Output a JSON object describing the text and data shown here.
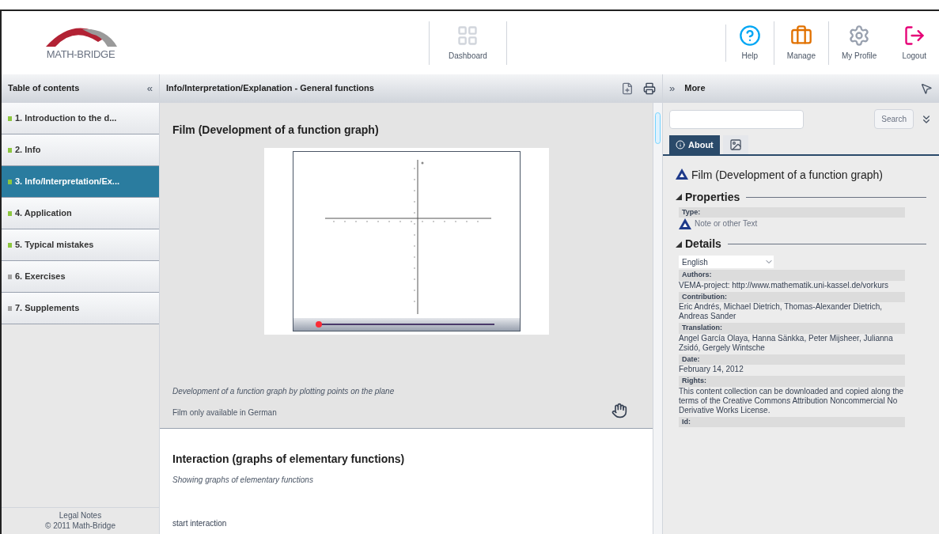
{
  "header": {
    "logo": "MATH-BRIDGE",
    "nav": [
      {
        "kind": "dashboard",
        "label": "Dashboard"
      },
      {
        "kind": "help",
        "label": "Help"
      },
      {
        "kind": "manage",
        "label": "Manage"
      },
      {
        "kind": "profile",
        "label": "My Profile"
      },
      {
        "kind": "logout",
        "label": "Logout"
      }
    ]
  },
  "sidebar": {
    "title": "Table of contents",
    "collapse": "«",
    "items": [
      {
        "label": "1. Introduction to the d...",
        "selected": false,
        "color": "#8cc63f"
      },
      {
        "label": "2. Info",
        "selected": false,
        "color": "#8cc63f"
      },
      {
        "label": "3. Info/Interpretation/Ex...",
        "selected": true,
        "color": "#8cc63f"
      },
      {
        "label": "4. Application",
        "selected": false,
        "color": "#8cc63f"
      },
      {
        "label": "5. Typical mistakes",
        "selected": false,
        "color": "#8cc63f"
      },
      {
        "label": "6. Exercises",
        "selected": false,
        "color": "#a0a0a0"
      },
      {
        "label": "7. Supplements",
        "selected": false,
        "color": "#a0a0a0"
      }
    ],
    "footer": [
      "Legal Notes",
      "© 2011 Math-Bridge"
    ]
  },
  "main": {
    "title": "Info/Interpretation/Explanation - General functions",
    "sections": [
      {
        "title": "Film (Development of a function graph)",
        "kind": "film",
        "caption": "Development of a function graph by plotting points on the plane",
        "note": "Film only available in German"
      },
      {
        "title": "Interaction (graphs of elementary functions)",
        "kind": "interaction",
        "caption": "Showing graphs of elementary functions",
        "note": "start interaction"
      }
    ]
  },
  "more": {
    "title": "More",
    "expand": "»",
    "search_button": "Search",
    "tabs": [
      {
        "kind": "about",
        "label": "About",
        "selected": true
      },
      {
        "kind": "icon",
        "selected": false
      }
    ],
    "item_title": "Film (Development of a function graph)",
    "properties": {
      "title": "Properties",
      "expanded": true,
      "fields": [
        {
          "label": "Type:",
          "value": "Note or other Text"
        }
      ]
    },
    "details": {
      "title": "Details",
      "expanded": true,
      "language": "English",
      "fields": [
        {
          "label": "Authors:",
          "value": "VEMA-project: http://www.mathematik.uni-kassel.de/vorkurs"
        },
        {
          "label": "Contribution:",
          "value": "Eric Andrés, Michael Dietrich, Thomas-Alexander Dietrich, Andreas Sander"
        },
        {
          "label": "Translation:",
          "value": "Angel García Olaya, Hanna Sänkka, Peter Mijsheer, Julianna Zsidó, Gergely Wintsche"
        },
        {
          "label": "Date:",
          "value": "February 14, 2012"
        },
        {
          "label": "Rights:",
          "value": "This content collection can be downloaded and copied along the terms of the Creative Commons Attribution Noncommercial No Derivative Works License."
        },
        {
          "label": "Id:"
        }
      ]
    }
  }
}
